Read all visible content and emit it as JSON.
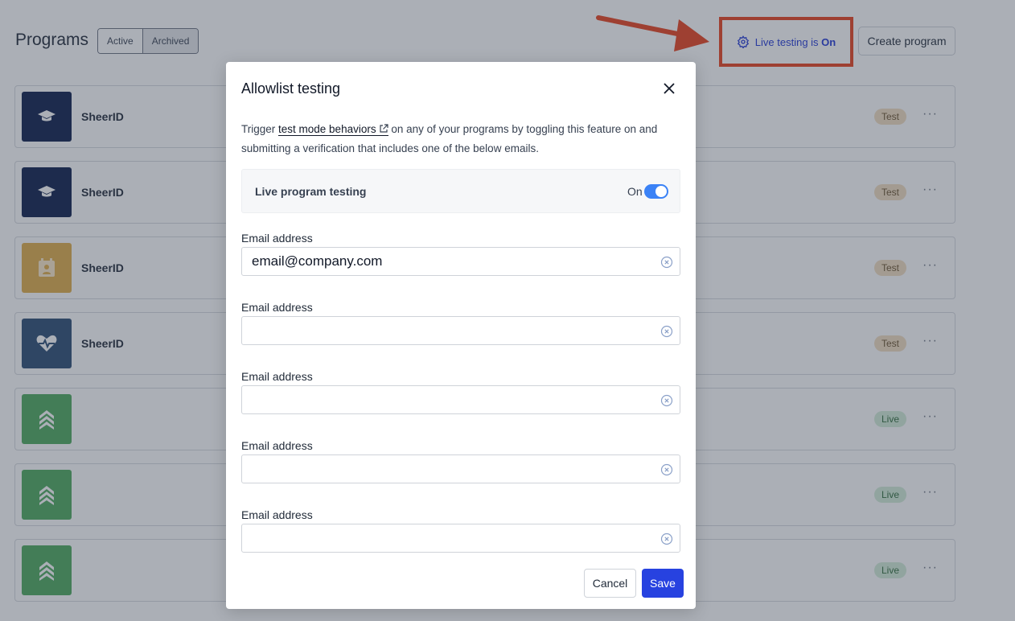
{
  "page": {
    "title": "Programs",
    "filter_tabs": [
      "Active",
      "Archived"
    ],
    "live_testing": {
      "prefix": "Live testing is ",
      "state": "On"
    },
    "create_label": "Create program"
  },
  "programs": [
    {
      "name": "SheerID",
      "status": "Test",
      "icon": "graduation-cap-icon",
      "color": "#0b1d4a"
    },
    {
      "name": "SheerID",
      "status": "Test",
      "icon": "graduation-cap-icon",
      "color": "#0b1d4a"
    },
    {
      "name": "SheerID",
      "status": "Test",
      "icon": "calendar-person-icon",
      "color": "#e1ac48"
    },
    {
      "name": "SheerID",
      "status": "Test",
      "icon": "heart-pulse-icon",
      "color": "#2a4a73"
    },
    {
      "name": "",
      "status": "Live",
      "icon": "chevrons-up-icon",
      "color": "#4caa5c"
    },
    {
      "name": "",
      "status": "Live",
      "icon": "chevrons-up-icon",
      "color": "#4caa5c"
    },
    {
      "name": "",
      "status": "Live",
      "icon": "chevrons-up-icon",
      "color": "#4caa5c"
    }
  ],
  "modal": {
    "title": "Allowlist testing",
    "description_before": "Trigger ",
    "description_link": "test mode behaviors",
    "description_after": " on any of your programs by toggling this feature on and submitting a verification that includes one of the below emails.",
    "toggle_label": "Live program testing",
    "toggle_state": "On",
    "fields": [
      {
        "label": "Email address",
        "value": "email@company.com"
      },
      {
        "label": "Email address",
        "value": ""
      },
      {
        "label": "Email address",
        "value": ""
      },
      {
        "label": "Email address",
        "value": ""
      },
      {
        "label": "Email address",
        "value": ""
      }
    ],
    "cancel_label": "Cancel",
    "save_label": "Save"
  },
  "colors": {
    "accent": "#2742e0",
    "annotation": "#e8401c",
    "toggle_on": "#3b82f6"
  }
}
